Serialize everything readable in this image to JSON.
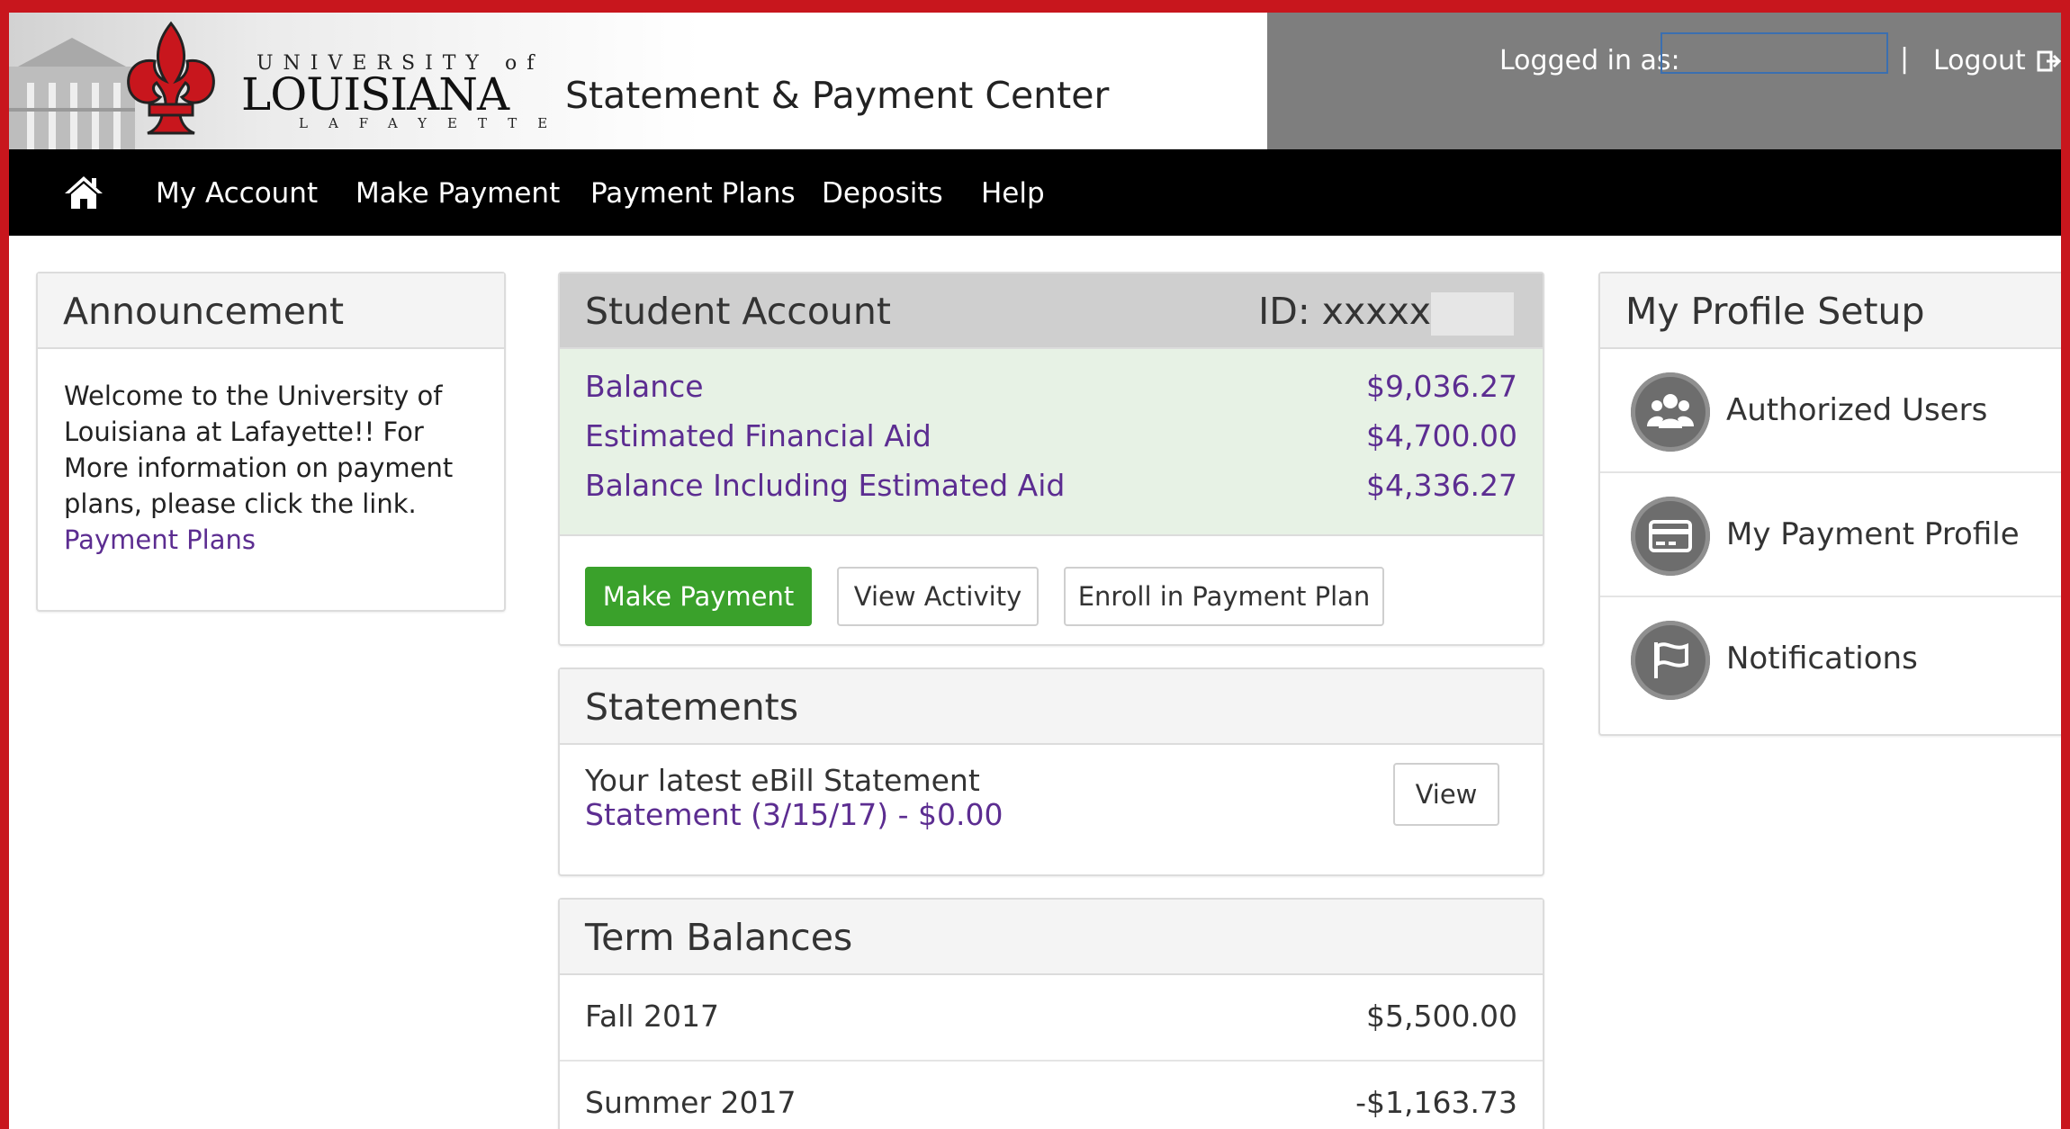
{
  "header": {
    "logo": {
      "line1": "UNIVERSITY of",
      "line2": "LOUISIANA",
      "line3": "LAFAYETTE"
    },
    "app_title": "Statement & Payment Center",
    "logged_in_label": "Logged in as:",
    "separator": "|",
    "logout_label": "Logout"
  },
  "nav": {
    "home_icon": "home-icon",
    "items": [
      "My Account",
      "Make Payment",
      "Payment Plans",
      "Deposits",
      "Help"
    ]
  },
  "announcement": {
    "title": "Announcement",
    "text": "Welcome to the University of Louisiana at Lafayette!! For More information on payment plans, please click the link.",
    "link_label": "Payment Plans"
  },
  "student_account": {
    "title": "Student Account",
    "id_label": "ID: xxxxx",
    "rows": [
      {
        "label": "Balance",
        "value": "$9,036.27"
      },
      {
        "label": "Estimated Financial Aid",
        "value": "$4,700.00"
      },
      {
        "label": "Balance Including Estimated Aid",
        "value": "$4,336.27"
      }
    ],
    "buttons": {
      "make_payment": "Make Payment",
      "view_activity": "View Activity",
      "enroll": "Enroll in Payment Plan"
    }
  },
  "statements": {
    "title": "Statements",
    "latest_label": "Your latest eBill Statement",
    "latest_link": "Statement (3/15/17) - $0.00",
    "view_label": "View"
  },
  "term_balances": {
    "title": "Term Balances",
    "rows": [
      {
        "term": "Fall 2017",
        "amount": "$5,500.00"
      },
      {
        "term": "Summer 2017",
        "amount": "-$1,163.73"
      }
    ]
  },
  "profile": {
    "title": "My Profile Setup",
    "items": [
      {
        "label": "Authorized Users",
        "icon": "users-icon"
      },
      {
        "label": "My Payment Profile",
        "icon": "credit-card-icon"
      },
      {
        "label": "Notifications",
        "icon": "flag-icon"
      }
    ]
  },
  "colors": {
    "brand_red": "#c8161d",
    "nav_bg": "#000000",
    "link_purple": "#5c2d91",
    "button_green": "#3aa12b",
    "account_bg": "#e7f2e5"
  }
}
